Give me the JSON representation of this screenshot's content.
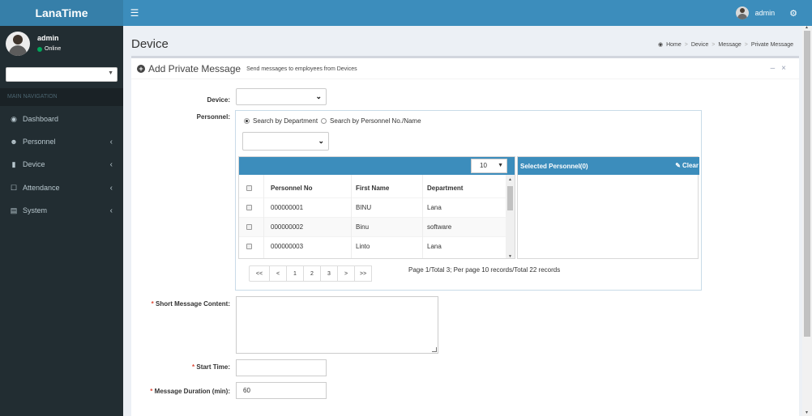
{
  "app": {
    "logo": "LanaTime"
  },
  "header": {
    "user_name": "admin"
  },
  "sidebar": {
    "user": {
      "name": "admin",
      "status": "Online"
    },
    "nav_header": "MAIN NAVIGATION",
    "items": [
      {
        "label": "Dashboard",
        "icon": "dashboard-icon"
      },
      {
        "label": "Personnel",
        "icon": "users-icon"
      },
      {
        "label": "Device",
        "icon": "device-icon"
      },
      {
        "label": "Attendance",
        "icon": "attendance-icon"
      },
      {
        "label": "System",
        "icon": "laptop-icon"
      }
    ]
  },
  "page": {
    "title": "Device",
    "breadcrumb": [
      "Home",
      "Device",
      "Message",
      "Private Message"
    ]
  },
  "box": {
    "title": "Add Private Message",
    "subtitle": "Send messages to employees from Devices"
  },
  "form": {
    "device_label": "Device:",
    "personnel_label": "Personnel:",
    "radio_department": "Search by Department",
    "radio_personnel": "Search by Personnel No./Name",
    "page_size": "10",
    "columns": [
      "Personnel No",
      "First Name",
      "Department"
    ],
    "rows": [
      {
        "no": "000000001",
        "first_name": "BINU",
        "department": "Lana"
      },
      {
        "no": "000000002",
        "first_name": "Binu",
        "department": "software"
      },
      {
        "no": "000000003",
        "first_name": "Linto",
        "department": "Lana"
      }
    ],
    "selected_title": "Selected Personnel(0)",
    "clear_label": "Clear",
    "pager": [
      "<<",
      "<",
      "1",
      "2",
      "3",
      ">",
      ">>"
    ],
    "page_info": "Page 1/Total 3; Per page 10 records/Total 22 records",
    "short_msg_label": "Short Message Content:",
    "start_time_label": "Start Time:",
    "duration_label": "Message Duration (min):",
    "duration_value": "60"
  }
}
